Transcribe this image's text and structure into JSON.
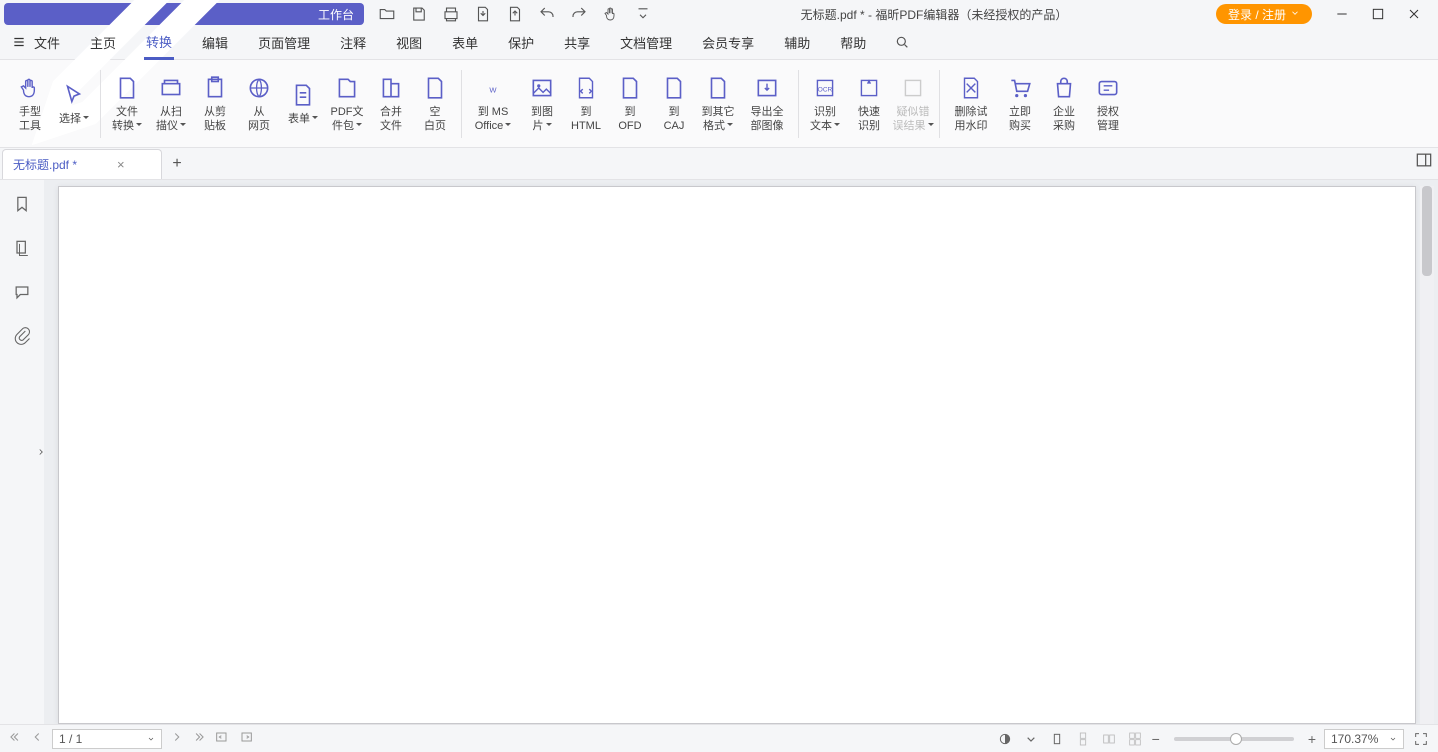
{
  "titlebar": {
    "workspace": "工作台",
    "title": "无标题.pdf * - 福昕PDF编辑器（未经授权的产品）",
    "login": "登录 / 注册"
  },
  "menubar": {
    "file": "文件",
    "items": [
      "主页",
      "转换",
      "编辑",
      "页面管理",
      "注释",
      "视图",
      "表单",
      "保护",
      "共享",
      "文档管理",
      "会员专享",
      "辅助",
      "帮助"
    ],
    "active_index": 1
  },
  "ribbon": {
    "hand": "手型\n工具",
    "select": "选择",
    "file_convert": "文件\n转换",
    "from_scanner": "从扫\n描仪",
    "from_clipboard": "从剪\n贴板",
    "from_web": "从\n网页",
    "form": "表单",
    "pdf_package": "PDF文\n件包",
    "merge": "合并\n文件",
    "blank_page": "空\n白页",
    "to_ms_office": "到 MS\nOffice",
    "to_image": "到图\n片",
    "to_html": "到\nHTML",
    "to_ofd": "到\nOFD",
    "to_caj": "到\nCAJ",
    "to_other": "到其它\n格式",
    "export_all_images": "导出全\n部图像",
    "ocr_text": "识别\n文本",
    "quick_ocr": "快速\n识别",
    "suspect_result": "疑似错\n误结果",
    "remove_trial_watermark": "删除试\n用水印",
    "buy_now": "立即\n购买",
    "enterprise_purchase": "企业\n采购",
    "license_manage": "授权\n管理"
  },
  "tabs": {
    "doc": "无标题.pdf *"
  },
  "statusbar": {
    "page": "1 / 1",
    "zoom": "170.37%"
  }
}
